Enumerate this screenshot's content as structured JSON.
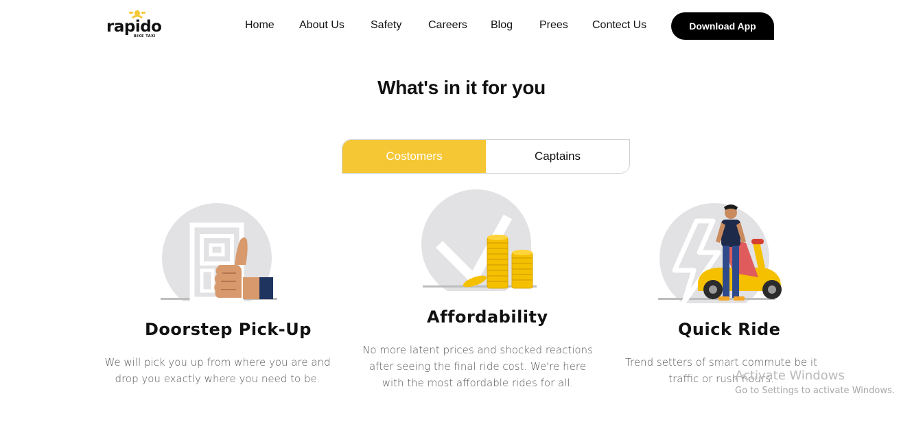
{
  "header": {
    "logo": {
      "text": "rapido",
      "subtitle": "BIKE TAXI"
    },
    "nav": [
      {
        "label": "Home"
      },
      {
        "label": "About Us"
      },
      {
        "label": "Safety"
      },
      {
        "label": "Careers"
      },
      {
        "label": "Blog"
      },
      {
        "label": "Prees"
      },
      {
        "label": "Contect Us"
      }
    ],
    "download_label": "Download App"
  },
  "section": {
    "title": "What's in it for you",
    "tabs": [
      {
        "label": "Costomers",
        "active": true
      },
      {
        "label": "Captains",
        "active": false
      }
    ]
  },
  "features": [
    {
      "icon": "thumbs-up-doorstep-icon",
      "title": "Doorstep Pick-Up",
      "description": "We will pick you up from where you are and drop you exactly where you need to be."
    },
    {
      "icon": "coins-checkmark-icon",
      "title": "Affordability",
      "description": "No more latent prices and shocked reactions after seeing the final ride cost. We're here with the most affordable rides for all."
    },
    {
      "icon": "rider-scooter-icon",
      "title": "Quick Ride",
      "description": "Trend setters of smart commute be it traffic or rush hours."
    }
  ],
  "watermark": {
    "line1": "Activate Windows",
    "line2": "Go to Settings to activate Windows."
  },
  "colors": {
    "accent": "#f6c735",
    "button_bg": "#000000",
    "icon_circle": "#e2e1e3"
  }
}
